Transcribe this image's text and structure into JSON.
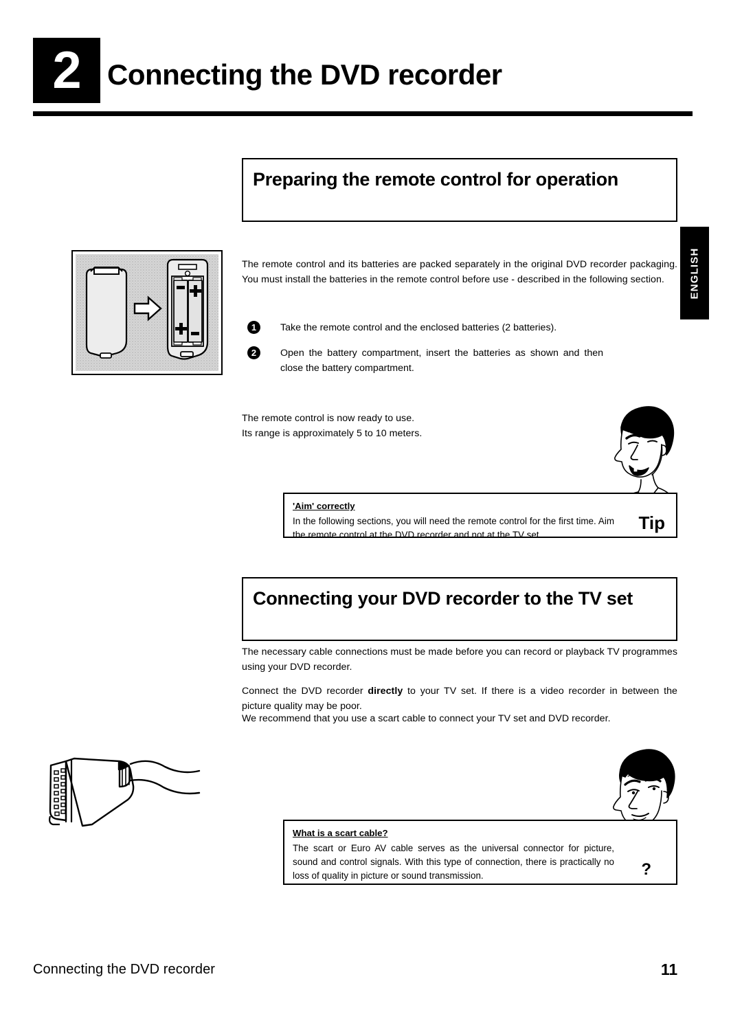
{
  "chapter": {
    "number": "2",
    "title": "Connecting the DVD recorder"
  },
  "side_tab": {
    "label": "ENGLISH"
  },
  "sections": [
    {
      "heading": "Preparing the remote control for operation",
      "intro": "The remote control and its batteries are packed separately in the original DVD recorder packaging. You must install the batteries in the remote control before use - described in the following section.",
      "steps": [
        {
          "number": "1",
          "text": "Take the remote control and the enclosed batteries (2 batteries)."
        },
        {
          "number": "2",
          "text": "Open the battery compartment, insert the batteries as shown and then close the battery compartment."
        }
      ],
      "after_text_line_1": "The remote control is now ready to use.",
      "after_text_line_2": "Its range is approximately 5 to 10 meters.",
      "callout": {
        "title": "'Aim' correctly",
        "body": "In the following sections, you will need the remote control for the first time. Aim the remote control at the DVD recorder and not at the TV set.",
        "badge": "Tip"
      }
    },
    {
      "heading": "Connecting your DVD recorder to the TV set",
      "para_1": "The necessary cable connections must be made before you can record or playback TV programmes using your DVD recorder.",
      "para_2_before": "Connect the DVD recorder ",
      "para_2_bold": "directly",
      "para_2_after": " to your TV set. If there is a video recorder in between the picture quality may be poor.",
      "para_3": "We recommend that you use a scart cable to connect your TV set and DVD recorder.",
      "callout": {
        "title": "What is a scart cable?",
        "body": "The scart or Euro AV cable serves as the universal connector for picture, sound and control signals. With this type of connection, there is practically no loss of quality in picture or sound transmission.",
        "badge": "?"
      }
    }
  ],
  "figures": {
    "remote_control": "remote-control-battery-diagram",
    "scart_cable": "scart-connector-illustration",
    "tip_cartoon": "smiling-man-cartoon",
    "question_cartoon": "puzzled-man-cartoon"
  },
  "footer": {
    "title": "Connecting the DVD recorder",
    "page_number": "11"
  },
  "colors": {
    "ink": "#000000",
    "paper": "#ffffff",
    "figure_fill": "#d9d9d9"
  }
}
